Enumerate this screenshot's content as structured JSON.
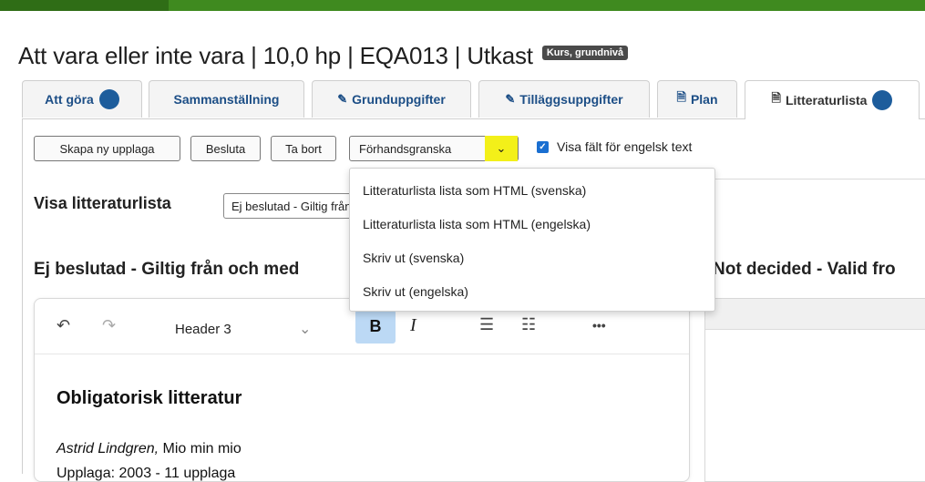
{
  "header": {
    "title": "Att vara eller inte vara | 10,0 hp | EQA013 | Utkast",
    "badge": "Kurs, grundnivå"
  },
  "tabs": [
    {
      "label": "Att göra",
      "icon": "dot"
    },
    {
      "label": "Sammanställning"
    },
    {
      "label": "Grunduppgifter",
      "icon": "pencil-icon"
    },
    {
      "label": "Tilläggsuppgifter",
      "icon": "pencil-icon"
    },
    {
      "label": "Plan",
      "icon": "document-icon"
    },
    {
      "label": "Litteraturlista",
      "icon": "document-icon",
      "active": true
    }
  ],
  "actions": {
    "create_label": "Skapa ny upplaga",
    "decide_label": "Besluta",
    "delete_label": "Ta bort",
    "preview_label": "Förhandsgranska",
    "english_checkbox_label": "Visa fält för engelsk text",
    "english_checked": true
  },
  "preview_menu": {
    "items": [
      "Litteraturlista lista som HTML (svenska)",
      "Litteraturlista lista som HTML (engelska)",
      "Skriv ut (svenska)",
      "Skriv ut (engelska)"
    ]
  },
  "list_selector": {
    "label": "Visa litteraturlista",
    "value": "Ej beslutad - Giltig från och med"
  },
  "sections": {
    "left_heading": "Ej beslutad - Giltig från och med",
    "right_heading": "Not decided - Valid fro"
  },
  "editor": {
    "style_select": "Header 3",
    "bold_label": "B",
    "italic_label": "I",
    "more_label": "•••",
    "doc_heading": "Obligatorisk litteratur",
    "author": "Astrid Lindgren,",
    "book": " Mio min mio",
    "edition": "Upplaga: 2003 - 11 upplaga"
  },
  "colors": {
    "top_bar": "#3f8a1f",
    "tab_text": "#1c4e86",
    "badge_dot": "#1d5d9c",
    "highlight": "#f3f019",
    "bold_active": "#bcd9f5"
  }
}
